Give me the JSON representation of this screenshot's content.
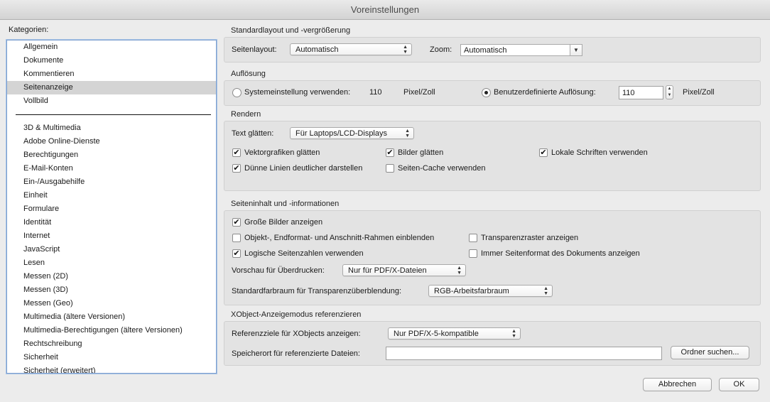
{
  "window": {
    "title": "Voreinstellungen"
  },
  "categories": {
    "label": "Kategorien:",
    "top": [
      "Allgemein",
      "Dokumente",
      "Kommentieren",
      "Seitenanzeige",
      "Vollbild"
    ],
    "selected": "Seitenanzeige",
    "rest": [
      "3D & Multimedia",
      "Adobe Online-Dienste",
      "Berechtigungen",
      "E-Mail-Konten",
      "Ein-/Ausgabehilfe",
      "Einheit",
      "Formulare",
      "Identität",
      "Internet",
      "JavaScript",
      "Lesen",
      "Messen (2D)",
      "Messen (3D)",
      "Messen (Geo)",
      "Multimedia (ältere Versionen)",
      "Multimedia-Berechtigungen (ältere Versionen)",
      "Rechtschreibung",
      "Sicherheit",
      "Sicherheit (erweitert)"
    ]
  },
  "layout_group": {
    "title": "Standardlayout und -vergrößerung",
    "page_layout_label": "Seitenlayout:",
    "page_layout_value": "Automatisch",
    "zoom_label": "Zoom:",
    "zoom_value": "Automatisch"
  },
  "resolution_group": {
    "title": "Auflösung",
    "system_label": "Systemeinstellung verwenden:",
    "system_value": "110",
    "system_unit": "Pixel/Zoll",
    "custom_label": "Benutzerdefinierte Auflösung:",
    "custom_value": "110",
    "custom_unit": "Pixel/Zoll"
  },
  "render_group": {
    "title": "Rendern",
    "smooth_text_label": "Text glätten:",
    "smooth_text_value": "Für Laptops/LCD-Displays",
    "vector_label": "Vektorgrafiken glätten",
    "images_label": "Bilder glätten",
    "local_fonts_label": "Lokale Schriften verwenden",
    "thin_lines_label": "Dünne Linien deutlicher darstellen",
    "page_cache_label": "Seiten-Cache verwenden"
  },
  "content_group": {
    "title": "Seiteninhalt und -informationen",
    "large_images_label": "Große Bilder anzeigen",
    "art_trim_label": "Objekt-, Endformat- und Anschnitt-Rahmen einblenden",
    "transparency_grid_label": "Transparenzraster anzeigen",
    "logical_pages_label": "Logische Seitenzahlen verwenden",
    "doc_page_size_label": "Immer Seitenformat des Dokuments anzeigen",
    "overprint_label": "Vorschau für Überdrucken:",
    "overprint_value": "Nur für PDF/X-Dateien",
    "blend_space_label": "Standardfarbraum für Transparenzüberblendung:",
    "blend_space_value": "RGB-Arbeitsfarbraum"
  },
  "xobject_group": {
    "title": "XObject-Anzeigemodus referenzieren",
    "targets_label": "Referenzziele für XObjects anzeigen:",
    "targets_value": "Nur PDF/X-5-kompatible",
    "location_label": "Speicherort für referenzierte Dateien:",
    "location_value": "",
    "browse_label": "Ordner suchen..."
  },
  "footer": {
    "cancel_label": "Abbrechen",
    "ok_label": "OK"
  },
  "icons": {
    "check": "✔",
    "up": "▲",
    "down": "▼"
  }
}
